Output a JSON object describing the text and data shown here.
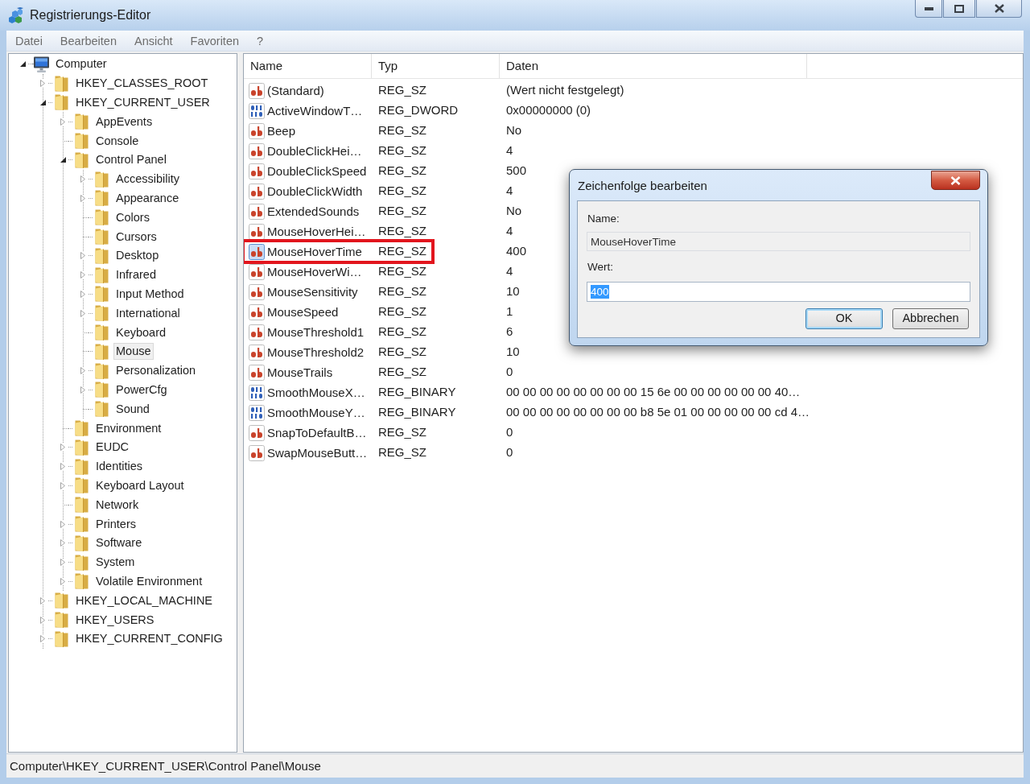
{
  "window": {
    "title": "Registrierungs-Editor"
  },
  "menu": [
    {
      "label": "Datei",
      "disabled": true
    },
    {
      "label": "Bearbeiten",
      "disabled": true
    },
    {
      "label": "Ansicht",
      "disabled": true
    },
    {
      "label": "Favoriten",
      "disabled": true
    },
    {
      "label": "?",
      "disabled": true
    }
  ],
  "tree": [
    {
      "kind": "computer",
      "label": "Computer",
      "expanded": true,
      "selected": false,
      "children": [
        {
          "kind": "folder",
          "label": "HKEY_CLASSES_ROOT",
          "expanded": false,
          "selected": false
        },
        {
          "kind": "folder",
          "label": "HKEY_CURRENT_USER",
          "expanded": true,
          "selected": false,
          "children": [
            {
              "kind": "folder",
              "label": "AppEvents",
              "expanded": false,
              "selected": false
            },
            {
              "kind": "folder",
              "label": "Console",
              "selected": false
            },
            {
              "kind": "folder",
              "label": "Control Panel",
              "expanded": true,
              "selected": false,
              "children": [
                {
                  "kind": "folder",
                  "label": "Accessibility",
                  "expanded": false,
                  "selected": false
                },
                {
                  "kind": "folder",
                  "label": "Appearance",
                  "expanded": false,
                  "selected": false
                },
                {
                  "kind": "folder",
                  "label": "Colors",
                  "selected": false
                },
                {
                  "kind": "folder",
                  "label": "Cursors",
                  "selected": false
                },
                {
                  "kind": "folder",
                  "label": "Desktop",
                  "expanded": false,
                  "selected": false
                },
                {
                  "kind": "folder",
                  "label": "Infrared",
                  "expanded": false,
                  "selected": false
                },
                {
                  "kind": "folder",
                  "label": "Input Method",
                  "expanded": false,
                  "selected": false
                },
                {
                  "kind": "folder",
                  "label": "International",
                  "expanded": false,
                  "selected": false
                },
                {
                  "kind": "folder",
                  "label": "Keyboard",
                  "selected": false
                },
                {
                  "kind": "folder",
                  "label": "Mouse",
                  "selected": true
                },
                {
                  "kind": "folder",
                  "label": "Personalization",
                  "expanded": false,
                  "selected": false
                },
                {
                  "kind": "folder",
                  "label": "PowerCfg",
                  "expanded": false,
                  "selected": false
                },
                {
                  "kind": "folder",
                  "label": "Sound",
                  "selected": false
                }
              ]
            },
            {
              "kind": "folder",
              "label": "Environment",
              "selected": false
            },
            {
              "kind": "folder",
              "label": "EUDC",
              "expanded": false,
              "selected": false
            },
            {
              "kind": "folder",
              "label": "Identities",
              "expanded": false,
              "selected": false
            },
            {
              "kind": "folder",
              "label": "Keyboard Layout",
              "expanded": false,
              "selected": false
            },
            {
              "kind": "folder",
              "label": "Network",
              "selected": false
            },
            {
              "kind": "folder",
              "label": "Printers",
              "expanded": false,
              "selected": false
            },
            {
              "kind": "folder",
              "label": "Software",
              "expanded": false,
              "selected": false
            },
            {
              "kind": "folder",
              "label": "System",
              "expanded": false,
              "selected": false
            },
            {
              "kind": "folder",
              "label": "Volatile Environment",
              "expanded": false,
              "selected": false
            }
          ]
        },
        {
          "kind": "folder",
          "label": "HKEY_LOCAL_MACHINE",
          "expanded": false,
          "selected": false
        },
        {
          "kind": "folder",
          "label": "HKEY_USERS",
          "expanded": false,
          "selected": false
        },
        {
          "kind": "folder",
          "label": "HKEY_CURRENT_CONFIG",
          "expanded": false,
          "selected": false
        }
      ]
    }
  ],
  "values": {
    "columns": [
      "Name",
      "Typ",
      "Daten"
    ],
    "rows": [
      {
        "kind": "string",
        "name": "(Standard)",
        "type": "REG_SZ",
        "data": "(Wert nicht festgelegt)",
        "selected": false,
        "marked": false
      },
      {
        "kind": "binary",
        "name": "ActiveWindowT…",
        "type": "REG_DWORD",
        "data": "0x00000000 (0)",
        "selected": false,
        "marked": false
      },
      {
        "kind": "string",
        "name": "Beep",
        "type": "REG_SZ",
        "data": "No",
        "selected": false,
        "marked": false
      },
      {
        "kind": "string",
        "name": "DoubleClickHei…",
        "type": "REG_SZ",
        "data": "4",
        "selected": false,
        "marked": false
      },
      {
        "kind": "string",
        "name": "DoubleClickSpeed",
        "type": "REG_SZ",
        "data": "500",
        "selected": false,
        "marked": false
      },
      {
        "kind": "string",
        "name": "DoubleClickWidth",
        "type": "REG_SZ",
        "data": "4",
        "selected": false,
        "marked": false
      },
      {
        "kind": "string",
        "name": "ExtendedSounds",
        "type": "REG_SZ",
        "data": "No",
        "selected": false,
        "marked": false
      },
      {
        "kind": "string",
        "name": "MouseHoverHei…",
        "type": "REG_SZ",
        "data": "4",
        "selected": false,
        "marked": false
      },
      {
        "kind": "string",
        "name": "MouseHoverTime",
        "type": "REG_SZ",
        "data": "400",
        "selected": true,
        "marked": true
      },
      {
        "kind": "string",
        "name": "MouseHoverWi…",
        "type": "REG_SZ",
        "data": "4",
        "selected": false,
        "marked": false
      },
      {
        "kind": "string",
        "name": "MouseSensitivity",
        "type": "REG_SZ",
        "data": "10",
        "selected": false,
        "marked": false
      },
      {
        "kind": "string",
        "name": "MouseSpeed",
        "type": "REG_SZ",
        "data": "1",
        "selected": false,
        "marked": false
      },
      {
        "kind": "string",
        "name": "MouseThreshold1",
        "type": "REG_SZ",
        "data": "6",
        "selected": false,
        "marked": false
      },
      {
        "kind": "string",
        "name": "MouseThreshold2",
        "type": "REG_SZ",
        "data": "10",
        "selected": false,
        "marked": false
      },
      {
        "kind": "string",
        "name": "MouseTrails",
        "type": "REG_SZ",
        "data": "0",
        "selected": false,
        "marked": false
      },
      {
        "kind": "binary",
        "name": "SmoothMouseX…",
        "type": "REG_BINARY",
        "data": "00 00 00 00 00 00 00 00 15 6e 00 00 00 00 00 00 40…",
        "selected": false,
        "marked": false
      },
      {
        "kind": "binary",
        "name": "SmoothMouseY…",
        "type": "REG_BINARY",
        "data": "00 00 00 00 00 00 00 00 b8 5e 01 00 00 00 00 00 cd 4…",
        "selected": false,
        "marked": false
      },
      {
        "kind": "string",
        "name": "SnapToDefaultB…",
        "type": "REG_SZ",
        "data": "0",
        "selected": false,
        "marked": false
      },
      {
        "kind": "string",
        "name": "SwapMouseButt…",
        "type": "REG_SZ",
        "data": "0",
        "selected": false,
        "marked": false
      }
    ]
  },
  "status_bar": "Computer\\HKEY_CURRENT_USER\\Control Panel\\Mouse",
  "dialog": {
    "title": "Zeichenfolge bearbeiten",
    "fields": [
      {
        "label": "Name:",
        "value": "MouseHoverTime",
        "readonly": true,
        "text_selected": false
      },
      {
        "label": "Wert:",
        "value": "400",
        "readonly": false,
        "text_selected": true
      }
    ],
    "buttons": [
      {
        "label": "OK",
        "default": true
      },
      {
        "label": "Abbrechen",
        "default": false
      }
    ]
  }
}
